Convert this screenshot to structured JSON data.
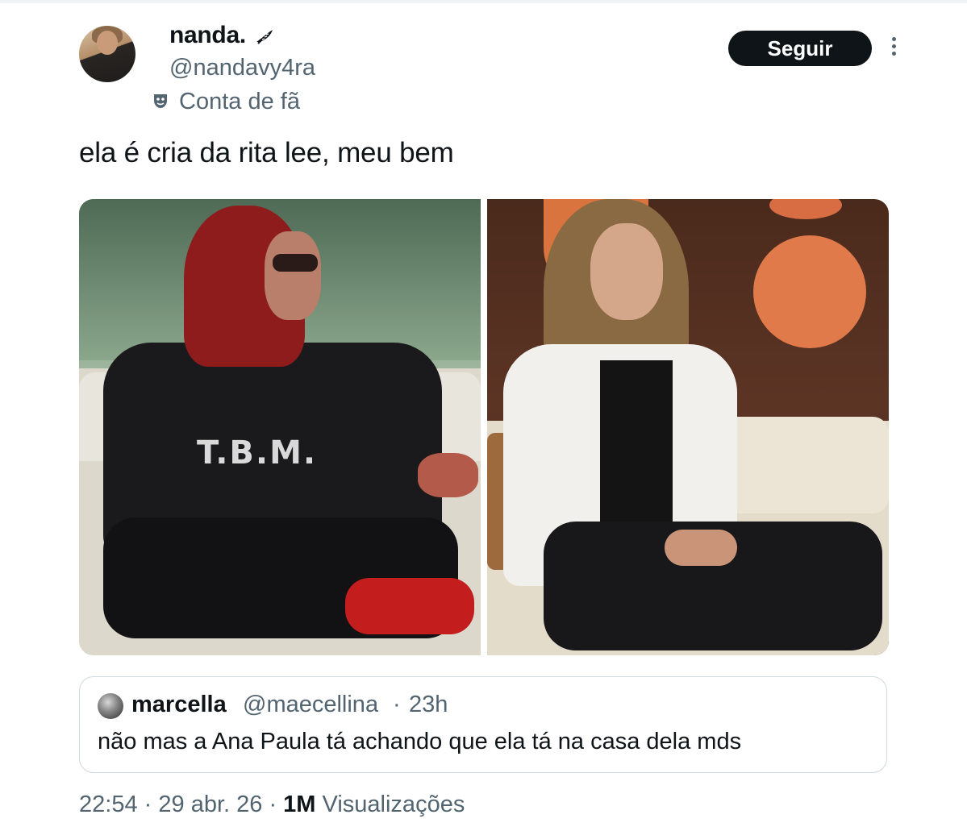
{
  "author": {
    "display_name": "nanda.",
    "handle": "@nandavy4ra",
    "label": "Conta de fã",
    "name_badge_icon": "feather-icon",
    "label_icon": "theater-mask-icon"
  },
  "actions": {
    "follow_label": "Seguir",
    "more_icon": "more-vertical-icon"
  },
  "tweet": {
    "text": "ela é cria da rita lee, meu bem",
    "left_photo_shirt_text": "T.B.M."
  },
  "quoted_tweet": {
    "display_name": "marcella",
    "handle": "@maecellina",
    "separator": "·",
    "time": "23h",
    "text": "não mas a Ana Paula tá achando que ela tá na casa dela mds"
  },
  "meta": {
    "time": "22:54",
    "sep1": "·",
    "date": "29 abr. 26",
    "sep2": "·",
    "views_count": "1M",
    "views_label": "Visualizações"
  },
  "colors": {
    "text_primary": "#0f1419",
    "text_secondary": "#536471",
    "button_bg": "#0f1419",
    "border": "#cfd9de"
  }
}
